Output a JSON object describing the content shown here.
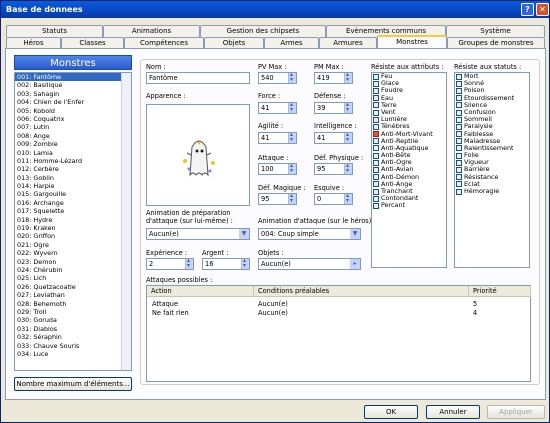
{
  "window": {
    "title": "Base de donnees",
    "help": "?",
    "close": "✕"
  },
  "tabs_row1": [
    "Statuts",
    "Animations",
    "Gestion des chipsets",
    "Evènements communs",
    "Système"
  ],
  "tabs_row2": [
    "Héros",
    "Classes",
    "Compétences",
    "Objets",
    "Armes",
    "Armures",
    "Monstres",
    "Groupes de monstres"
  ],
  "list": {
    "title": "Monstres",
    "items": [
      "001: Fantôme",
      "002: Basilique",
      "003: Sahagin",
      "004: Chien de l'Enfer",
      "005: Kobold",
      "006: Coquatrix",
      "007: Lutin",
      "008: Ange",
      "009: Zombie",
      "010: Lamia",
      "011: Homme-Lézard",
      "012: Cerbère",
      "013: Goblin",
      "014: Harpie",
      "015: Gargouille",
      "016: Archange",
      "017: Squelette",
      "018: Hydre",
      "019: Kraken",
      "020: Griffon",
      "021: Ogre",
      "022: Wyvern",
      "023: Demon",
      "024: Chérubin",
      "025: Lich",
      "026: Quetzacoatle",
      "027: Leviathan",
      "028: Behemoth",
      "029: Troll",
      "030: Goruda",
      "031: Diablos",
      "032: Séraphin",
      "033: Chauve Souris",
      "034: Luce"
    ],
    "max_button": "Nombre maximum d'éléments..."
  },
  "form": {
    "name_label": "Nom :",
    "name_value": "Fantôme",
    "appearance_label": "Apparence :",
    "pvmax_label": "PV Max :",
    "pvmax_value": "540",
    "pmmax_label": "PM Max :",
    "pmmax_value": "419",
    "force_label": "Force :",
    "force_value": "41",
    "defense_label": "Défense :",
    "defense_value": "39",
    "agilite_label": "Agilité :",
    "agilite_value": "41",
    "intelligence_label": "Intelligence :",
    "intelligence_value": "41",
    "attaque_label": "Attaque :",
    "attaque_value": "100",
    "defphys_label": "Déf. Physique :",
    "defphys_value": "95",
    "defmag_label": "Déf. Magique :",
    "defmag_value": "95",
    "esquive_label": "Esquive :",
    "esquive_value": "0",
    "anim_prep_label1": "Animation de préparation",
    "anim_prep_label2": "d'attaque (sur lui-même) :",
    "anim_prep_value": "Aucun(e)",
    "anim_att_label": "Animation d'attaque (sur le héros) :",
    "anim_att_value": "004: Coup simple",
    "exp_label": "Expérience :",
    "exp_value": "2",
    "argent_label": "Argent :",
    "argent_value": "16",
    "objets_label": "Objets :",
    "objets_value": "Aucun(e)",
    "attaques_label": "Attaques possibles :"
  },
  "attributes": {
    "label": "Résiste aux attributs :",
    "items": [
      "Feu",
      "Glace",
      "Foudre",
      "Eau",
      "Terre",
      "Vent",
      "Lumière",
      "Ténèbres",
      "Anti-Mort-Vivant",
      "Anti-Reptile",
      "Anti-Aquatique",
      "Anti-Bête",
      "Anti-Ogre",
      "Anti-Avian",
      "Anti-Démon",
      "Anti-Ange",
      "Tranchant",
      "Contondant",
      "Percant"
    ]
  },
  "statuses": {
    "label": "Résiste aux statuts :",
    "items": [
      "Mort",
      "Sonné",
      "Poison",
      "Etourdissement",
      "Silence",
      "Confusion",
      "Sommeil",
      "Paralysie",
      "Faiblesse",
      "Maladresse",
      "Ralentissement",
      "Folie",
      "Vigueur",
      "Barrière",
      "Résistance",
      "Eclat",
      "Hémoragie"
    ]
  },
  "actions_table": {
    "headers": [
      "Action",
      "Conditions préalables",
      "Priorité"
    ],
    "rows": [
      [
        "Attaque",
        "Aucun(e)",
        "5"
      ],
      [
        "Ne fait rien",
        "Aucun(e)",
        "4"
      ]
    ]
  },
  "buttons": {
    "ok": "OK",
    "cancel": "Annuler",
    "apply": "Appliquer",
    "more": "▸"
  }
}
